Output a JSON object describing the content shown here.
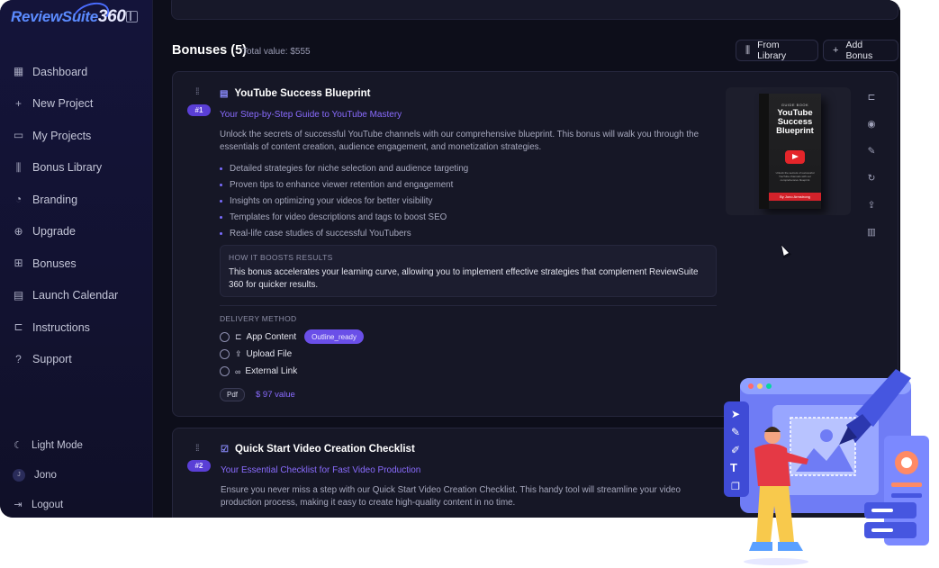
{
  "brand": {
    "name": "ReviewSuite",
    "suffix": "360"
  },
  "sidebar": {
    "items": [
      {
        "label": "Dashboard",
        "icon": "dashboard-icon"
      },
      {
        "label": "New Project",
        "icon": "plus-icon"
      },
      {
        "label": "My Projects",
        "icon": "folder-icon"
      },
      {
        "label": "Bonus Library",
        "icon": "library-icon"
      },
      {
        "label": "Branding",
        "icon": "palette-icon"
      },
      {
        "label": "Upgrade",
        "icon": "arrow-up-circle-icon"
      },
      {
        "label": "Bonuses",
        "icon": "gift-icon"
      },
      {
        "label": "Launch Calendar",
        "icon": "calendar-icon"
      },
      {
        "label": "Instructions",
        "icon": "book-open-icon"
      },
      {
        "label": "Support",
        "icon": "help-circle-icon"
      }
    ],
    "theme_toggle": "Light Mode",
    "user_initial": "J",
    "user_name": "Jono",
    "logout": "Logout"
  },
  "section": {
    "title": "Bonuses (5)",
    "total": "Total value: $555",
    "from_library": "From Library",
    "add_bonus": "Add Bonus"
  },
  "bonus1": {
    "number": "#1",
    "title": "YouTube Success Blueprint",
    "subtitle": "Your Step-by-Step Guide to YouTube Mastery",
    "description": "Unlock the secrets of successful YouTube channels with our comprehensive blueprint. This bonus will walk you through the essentials of content creation, audience engagement, and monetization strategies.",
    "bullets": [
      "Detailed strategies for niche selection and audience targeting",
      "Proven tips to enhance viewer retention and engagement",
      "Insights on optimizing your videos for better visibility",
      "Templates for video descriptions and tags to boost SEO",
      "Real-life case studies of successful YouTubers"
    ],
    "boost_heading": "HOW IT BOOSTS RESULTS",
    "boost_text": "This bonus accelerates your learning curve, allowing you to implement effective strategies that complement ReviewSuite 360 for quicker results.",
    "delivery_heading": "DELIVERY METHOD",
    "delivery": [
      "App Content",
      "Upload File",
      "External Link"
    ],
    "status_tag": "Outline_ready",
    "format": "Pdf",
    "value": "$  97 value",
    "book": {
      "label": "GUIDE BOOK",
      "title": "YouTube Success Blueprint",
      "blurb": "Unlock the secrets of successful YouTube channels with our comprehensive blueprint",
      "author": "By Jono Armstrong",
      "spine": "YouTube Success Blueprint"
    }
  },
  "bonus2": {
    "number": "#2",
    "title": "Quick Start Video Creation Checklist",
    "subtitle": "Your Essential Checklist for Fast Video Production",
    "description": "Ensure you never miss a step with our Quick Start Video Creation Checklist. This handy tool will streamline your video production process, making it easy to create high-quality content in no time."
  },
  "colors": {
    "accent": "#6a4fe8",
    "link": "#8a6cff",
    "background": "#0d0e1a"
  }
}
